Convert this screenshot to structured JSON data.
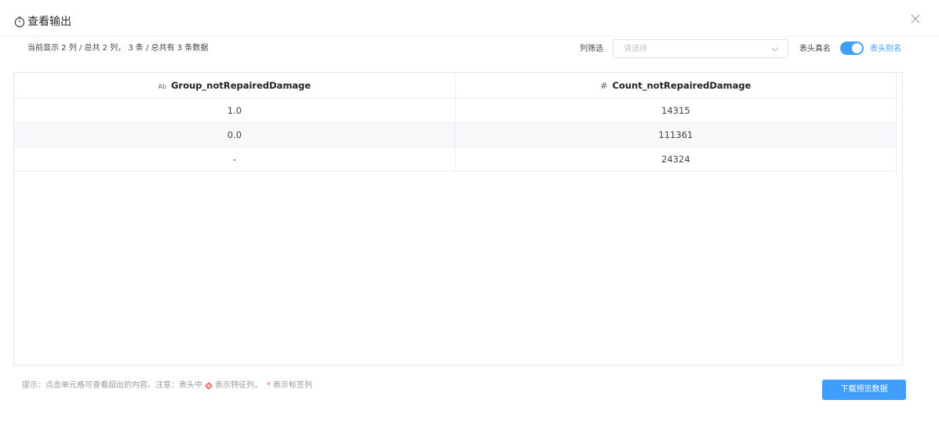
{
  "dialog": {
    "title": "查看输出",
    "icon": "clock-icon",
    "close_icon": "close-icon"
  },
  "toolbar": {
    "summary": "当前显示 2 列 / 总共 2 列， 3 条 / 总共有 3 条数据",
    "filter_label": "列筛选",
    "filter_placeholder": "请选择",
    "switch_left_label": "表头真名",
    "switch_right_label": "表头别名",
    "switch_on": true
  },
  "table": {
    "columns": [
      {
        "type_icon": "Ab",
        "label": "Group_notRepairedDamage"
      },
      {
        "type_icon": "#",
        "label": "Count_notRepairedDamage"
      }
    ],
    "rows": [
      [
        "1.0",
        "14315"
      ],
      [
        "0.0",
        "111361"
      ],
      [
        "-",
        "24324"
      ]
    ]
  },
  "footer": {
    "hint_prefix": "提示：点击单元格可查看超出的内容。注意：表头中",
    "hint_feature": "表示特征列，",
    "hint_star": "*",
    "hint_label": "表示标签列",
    "download_label": "下载预览数据"
  },
  "colors": {
    "accent": "#409eff",
    "feature_mark": "#f56c6c"
  }
}
